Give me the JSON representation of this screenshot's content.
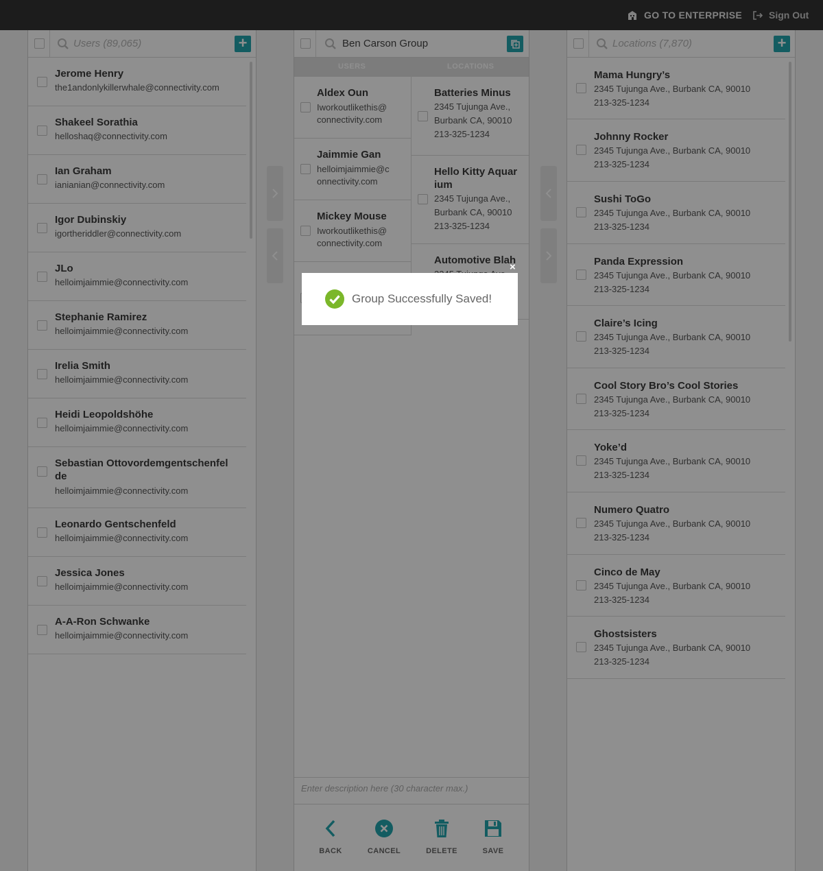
{
  "topbar": {
    "enterprise_label": "GO TO ENTERPRISE",
    "signout_label": "Sign Out"
  },
  "users_panel": {
    "search_placeholder": "Users (89,065)",
    "add_label": "+",
    "users": [
      {
        "name": "Jerome Henry",
        "email": "the1andonlykillerwhale@connectivity.com"
      },
      {
        "name": "Shakeel Sorathia",
        "email": "helloshaq@connectivity.com"
      },
      {
        "name": "Ian Graham",
        "email": "ianianian@connectivity.com"
      },
      {
        "name": "Igor Dubinskiy",
        "email": "igortheriddler@connectivity.com"
      },
      {
        "name": "JLo",
        "email": "helloimjaimmie@connectivity.com"
      },
      {
        "name": "Stephanie Ramirez",
        "email": "helloimjaimmie@connectivity.com"
      },
      {
        "name": "Irelia Smith",
        "email": "helloimjaimmie@connectivity.com"
      },
      {
        "name": "Heidi Leopoldshöhe",
        "email": "helloimjaimmie@connectivity.com"
      },
      {
        "name_line1": "Sebastian Ottovordemgentschenfel",
        "name_line2": "de",
        "email": "helloimjaimmie@connectivity.com"
      },
      {
        "name": "Leonardo Gentschenfeld",
        "email": "helloimjaimmie@connectivity.com"
      },
      {
        "name": "Jessica Jones",
        "email": "helloimjaimmie@connectivity.com"
      },
      {
        "name": "A-A-Ron Schwanke",
        "email": "helloimjaimmie@connectivity.com"
      }
    ]
  },
  "group_panel": {
    "group_name": "Ben Carson Group",
    "tab_users": "USERS",
    "tab_locations": "LOCATIONS",
    "users": [
      {
        "name": "Aldex Oun",
        "email_line1": "Iworkoutlikethis@",
        "email_line2": "connectivity.com"
      },
      {
        "name": "Jaimmie Gan",
        "email_line1": "helloimjaimmie@c",
        "email_line2": "onnectivity.com"
      },
      {
        "name": "Mickey Mouse",
        "email_line1": "Iworkoutlikethis@",
        "email_line2": "connectivity.com"
      }
    ],
    "locations": [
      {
        "name": "Batteries Minus",
        "addr_line1": "2345 Tujunga Ave.,",
        "addr_line2": "Burbank CA, 90010",
        "phone": "213-325-1234"
      },
      {
        "name_line1": "Hello Kitty Aquar",
        "name_line2": "ium",
        "addr_line1": "2345 Tujunga Ave.,",
        "addr_line2": "Burbank CA, 90010",
        "phone": "213-325-1234"
      },
      {
        "name": "Automotive Blah",
        "addr_line1": "2345 Tujunga Ave.,"
      }
    ],
    "description_placeholder": "Enter description here (30 character max.)",
    "actions": {
      "back": "BACK",
      "cancel": "CANCEL",
      "delete": "DELETE",
      "save": "SAVE"
    }
  },
  "locations_panel": {
    "search_placeholder": "Locations (7,870)",
    "add_label": "+",
    "locations": [
      {
        "name": "Mama Hungry’s",
        "address": "2345 Tujunga Ave., Burbank CA, 90010",
        "phone": "213-325-1234"
      },
      {
        "name": "Johnny Rocker",
        "address": "2345 Tujunga Ave., Burbank CA, 90010",
        "phone": "213-325-1234"
      },
      {
        "name": "Sushi ToGo",
        "address": "2345 Tujunga Ave., Burbank CA, 90010",
        "phone": "213-325-1234"
      },
      {
        "name": "Panda Expression",
        "address": "2345 Tujunga Ave., Burbank CA, 90010",
        "phone": "213-325-1234"
      },
      {
        "name": "Claire’s Icing",
        "address": "2345 Tujunga Ave., Burbank CA, 90010",
        "phone": "213-325-1234"
      },
      {
        "name": "Cool Story Bro’s Cool Stories",
        "address": "2345 Tujunga Ave., Burbank CA, 90010",
        "phone": "213-325-1234"
      },
      {
        "name": "Yoke’d",
        "address": "2345 Tujunga Ave., Burbank CA, 90010",
        "phone": "213-325-1234"
      },
      {
        "name": "Numero Quatro",
        "address": "2345 Tujunga Ave., Burbank CA, 90010",
        "phone": "213-325-1234"
      },
      {
        "name": "Cinco de May",
        "address": "2345 Tujunga Ave., Burbank CA, 90010",
        "phone": "213-325-1234"
      },
      {
        "name": "Ghostsisters",
        "address": "2345 Tujunga Ave., Burbank CA, 90010",
        "phone": "213-325-1234"
      }
    ]
  },
  "toast": {
    "message": "Group Successfully Saved!",
    "close_label": "×"
  },
  "colors": {
    "accent": "#22a4ad",
    "success": "#7bb72a",
    "topbar": "#333333"
  }
}
